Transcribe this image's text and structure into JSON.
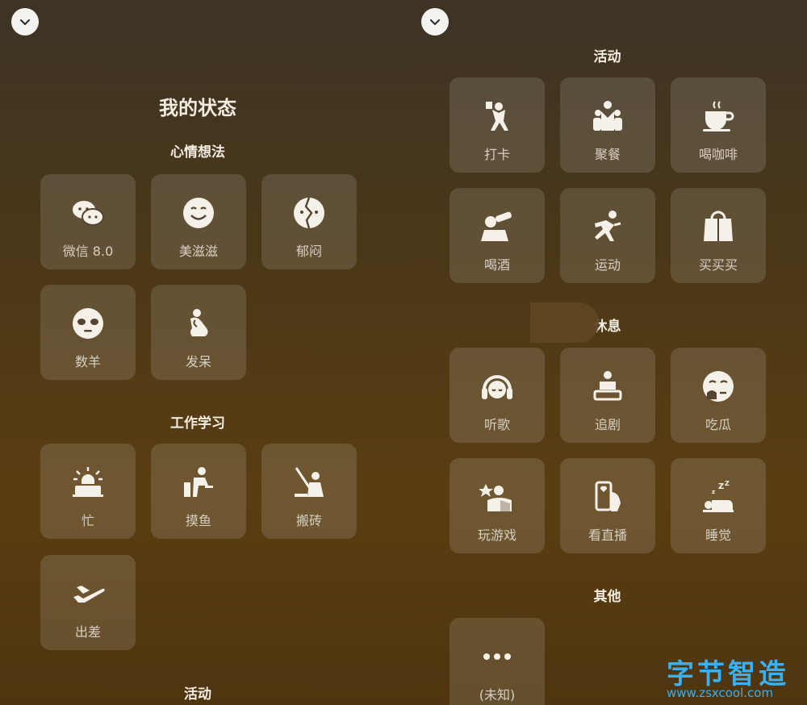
{
  "left": {
    "title": "我的状态",
    "sections": [
      {
        "title": "心情想法",
        "items": [
          {
            "label": "微信 8.0",
            "icon": "chat-bubbles-icon"
          },
          {
            "label": "美滋滋",
            "icon": "smile-face-icon"
          },
          {
            "label": "郁闷",
            "icon": "broken-face-icon"
          },
          {
            "label": "数羊",
            "icon": "sleepy-sheep-face-icon"
          },
          {
            "label": "发呆",
            "icon": "thinker-icon"
          }
        ]
      },
      {
        "title": "工作学习",
        "items": [
          {
            "label": "忙",
            "icon": "alarm-laptop-icon"
          },
          {
            "label": "摸鱼",
            "icon": "desk-person-icon"
          },
          {
            "label": "搬砖",
            "icon": "worker-icon"
          },
          {
            "label": "出差",
            "icon": "airplane-icon"
          }
        ]
      },
      {
        "title": "活动",
        "items": []
      }
    ]
  },
  "right": {
    "sections": [
      {
        "title": "活动",
        "items": [
          {
            "label": "打卡",
            "icon": "checkin-person-icon"
          },
          {
            "label": "聚餐",
            "icon": "group-people-icon"
          },
          {
            "label": "喝咖啡",
            "icon": "coffee-cup-icon"
          },
          {
            "label": "喝酒",
            "icon": "drinking-icon"
          },
          {
            "label": "运动",
            "icon": "running-icon"
          },
          {
            "label": "买买买",
            "icon": "shopping-bag-icon"
          }
        ]
      },
      {
        "title": "休息",
        "items": [
          {
            "label": "听歌",
            "icon": "headphones-icon"
          },
          {
            "label": "追剧",
            "icon": "tv-person-icon"
          },
          {
            "label": "吃瓜",
            "icon": "eating-face-icon"
          },
          {
            "label": "玩游戏",
            "icon": "game-player-icon"
          },
          {
            "label": "看直播",
            "icon": "phone-live-icon"
          },
          {
            "label": "睡觉",
            "icon": "sleeping-icon"
          }
        ]
      },
      {
        "title": "其他",
        "items": [
          {
            "label": "(未知)",
            "icon": "more-dots-icon"
          }
        ]
      }
    ]
  },
  "watermark": {
    "title": "字节智造",
    "url": "www.zsxcool.com"
  },
  "colors": {
    "text": "#f3ece1",
    "label": "#d8cfc2",
    "tile": "rgba(255,255,255,0.13)",
    "watermark": "#3ab0f0"
  }
}
